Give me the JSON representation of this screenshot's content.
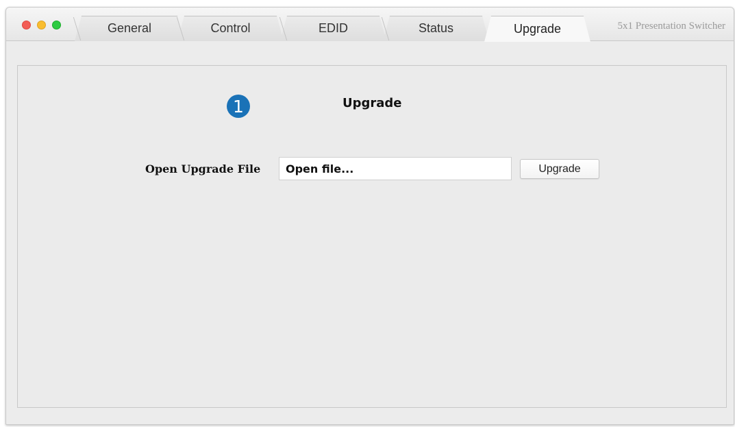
{
  "window": {
    "app_title": "5x1 Presentation Switcher",
    "tabs": [
      {
        "label": "General"
      },
      {
        "label": "Control"
      },
      {
        "label": "EDID"
      },
      {
        "label": "Status"
      },
      {
        "label": "Upgrade"
      }
    ],
    "active_tab": "Upgrade"
  },
  "upgrade_panel": {
    "step_badge": "1",
    "title": "Upgrade",
    "file_label": "Open Upgrade File",
    "file_value": "Open file...",
    "upgrade_button_label": "Upgrade"
  },
  "colors": {
    "badge": "#1a72b7",
    "close": "#f25d56",
    "minimize": "#f9bd30",
    "maximize": "#2ecb42"
  }
}
